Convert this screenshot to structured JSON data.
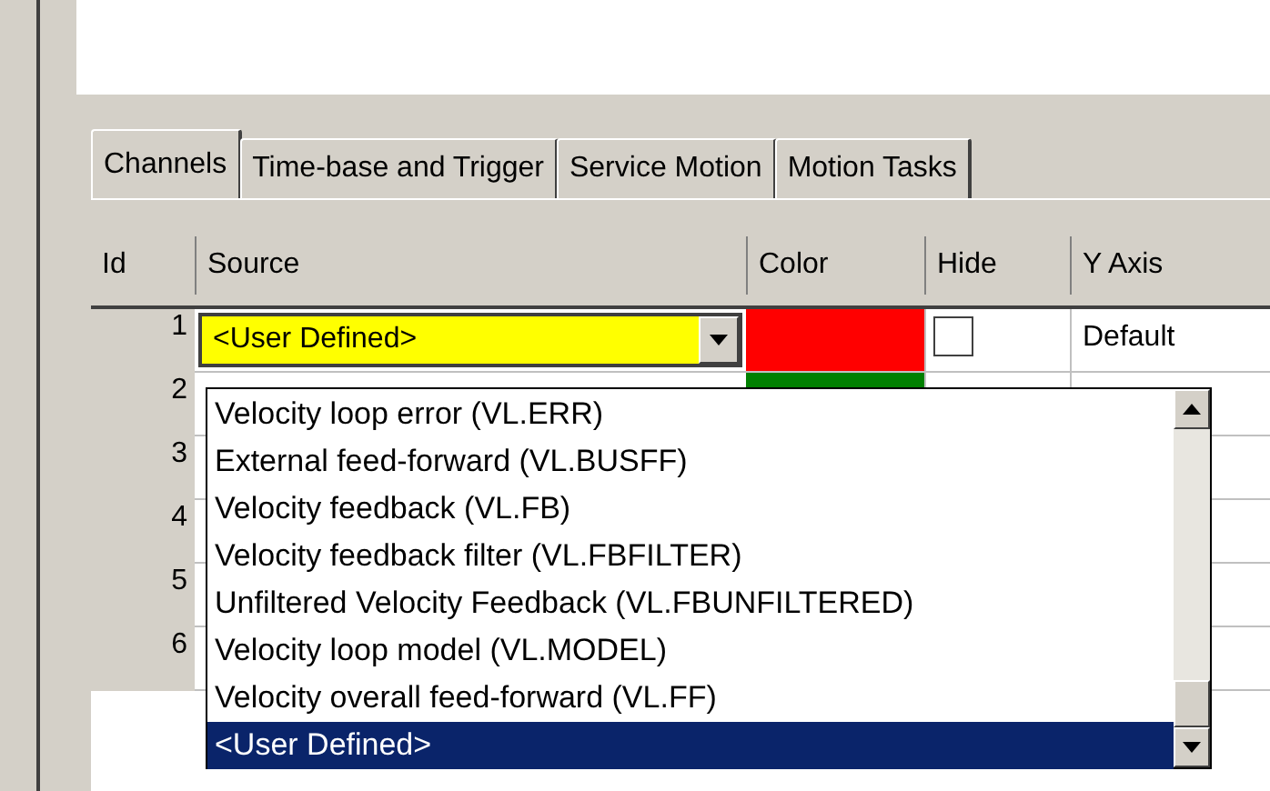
{
  "tabs": [
    {
      "label": "Channels",
      "selected": true
    },
    {
      "label": "Time-base and Trigger",
      "selected": false
    },
    {
      "label": "Service Motion",
      "selected": false
    },
    {
      "label": "Motion Tasks",
      "selected": false
    }
  ],
  "columns": [
    "Id",
    "Source",
    "Color",
    "Hide",
    "Y Axis"
  ],
  "rows": [
    {
      "id": "1",
      "source": "<User Defined>",
      "color": "#ff0000",
      "hide": false,
      "y_axis": "Default"
    },
    {
      "id": "2",
      "color": "#008000"
    },
    {
      "id": "3"
    },
    {
      "id": "4"
    },
    {
      "id": "5"
    },
    {
      "id": "6"
    }
  ],
  "dropdown": {
    "items": [
      {
        "label": "Velocity loop error (VL.ERR)",
        "selected": false
      },
      {
        "label": "External feed-forward (VL.BUSFF)",
        "selected": false
      },
      {
        "label": "Velocity feedback (VL.FB)",
        "selected": false
      },
      {
        "label": "Velocity feedback filter (VL.FBFILTER)",
        "selected": false
      },
      {
        "label": "Unfiltered Velocity Feedback (VL.FBUNFILTERED)",
        "selected": false
      },
      {
        "label": "Velocity loop model (VL.MODEL)",
        "selected": false
      },
      {
        "label": "Velocity overall feed-forward (VL.FF)",
        "selected": false
      },
      {
        "label": "<User Defined>",
        "selected": true
      }
    ]
  }
}
